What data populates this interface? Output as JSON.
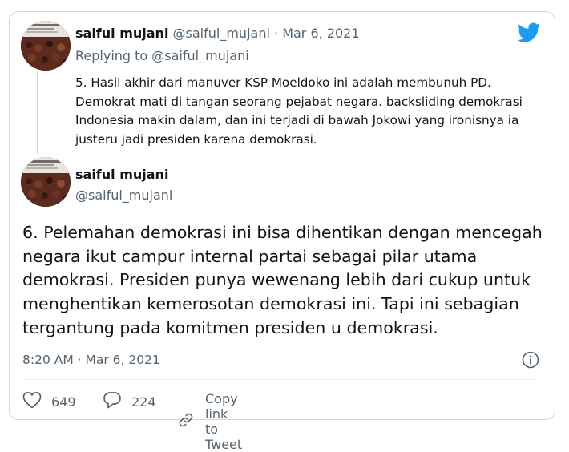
{
  "reply_tweet": {
    "name": "saiful mujani",
    "handle": "@saiful_mujani",
    "separator": "·",
    "date": "Mar 6, 2021",
    "replying_to": "Replying to @saiful_mujani",
    "text": "5. Hasil akhir dari manuver KSP Moeldoko ini adalah membunuh PD. Demokrat mati di tangan seorang pejabat negara. backsliding demokrasi Indonesia makin dalam, dan ini terjadi di bawah Jokowi yang ironisnya ia justeru jadi presiden karena demokrasi."
  },
  "main_tweet": {
    "name": "saiful mujani",
    "handle": "@saiful_mujani",
    "text": "6. Pelemahan demokrasi ini bisa dihentikan dengan mencegah negara ikut campur internal partai sebagai pilar utama demokrasi. Presiden punya wewenang lebih dari cukup untuk menghentikan kemerosotan demokrasi ini. Tapi ini sebagian tergantung pada komitmen presiden u demokrasi.",
    "timestamp": "8:20 AM · Mar 6, 2021"
  },
  "actions": {
    "likes": "649",
    "replies": "224",
    "copy_link": "Copy link to Tweet"
  },
  "icons": {
    "brand": "twitter-bird-icon",
    "info": "info-icon",
    "like": "heart-icon",
    "reply": "reply-bubble-icon",
    "copy": "link-icon"
  },
  "colors": {
    "twitter_blue": "#1d9bf0",
    "muted": "#536471",
    "text": "#0f1419",
    "border": "#cfd9de"
  }
}
